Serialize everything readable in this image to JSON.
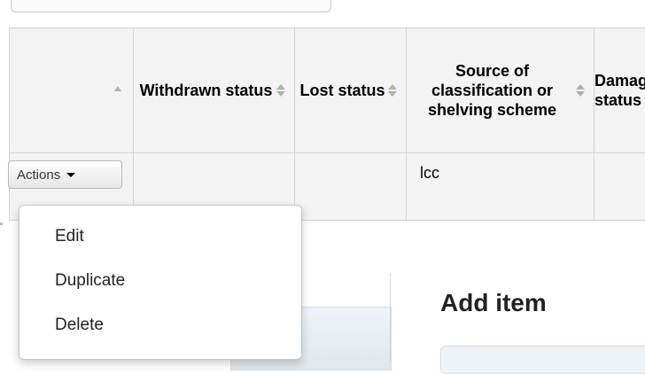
{
  "table": {
    "headers": [
      {
        "label": ""
      },
      {
        "label": "Withdrawn status"
      },
      {
        "label": "Lost status"
      },
      {
        "label": "Source of classification or shelving scheme"
      },
      {
        "label": "Damaged status"
      }
    ],
    "rows": [
      {
        "actions_label": "Actions",
        "classification_source": "lcc"
      }
    ]
  },
  "actions_menu": {
    "items": [
      "Edit",
      "Duplicate",
      "Delete"
    ]
  },
  "main": {
    "heading": "Add item"
  }
}
